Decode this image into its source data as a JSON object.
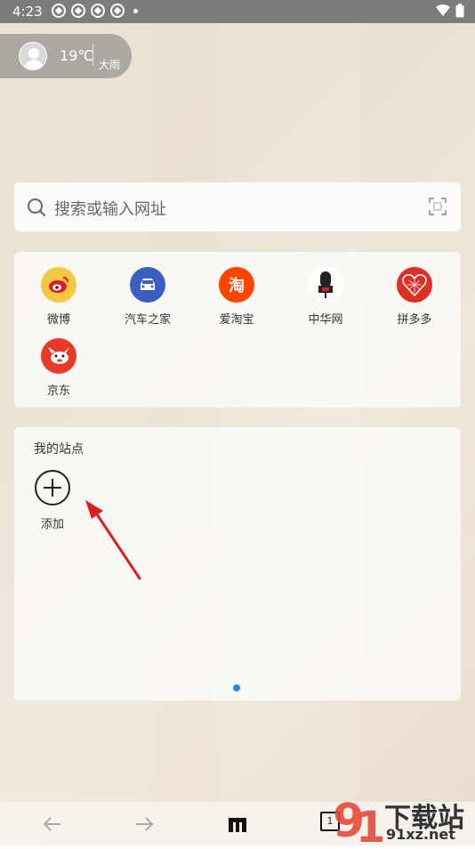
{
  "status_bar": {
    "time": "4:23"
  },
  "weather": {
    "temperature": "19℃",
    "condition": "大雨"
  },
  "search": {
    "placeholder": "搜索或输入网址"
  },
  "quick_links": [
    {
      "label": "微博",
      "icon": "weibo-icon",
      "color": "#f5c843"
    },
    {
      "label": "汽车之家",
      "icon": "autohome-icon",
      "color": "#3b5fc0"
    },
    {
      "label": "爱淘宝",
      "icon": "taobao-icon",
      "icon_text": "淘",
      "color": "#ff4400"
    },
    {
      "label": "中华网",
      "icon": "china-com-icon",
      "color": "#ffffff"
    },
    {
      "label": "拼多多",
      "icon": "pinduoduo-icon",
      "color": "#e02e24"
    },
    {
      "label": "京东",
      "icon": "jd-icon",
      "color": "#e83828"
    }
  ],
  "my_sites": {
    "title": "我的站点",
    "add_label": "添加"
  },
  "pager": {
    "current": 1,
    "total": 1
  },
  "bottom_bar": {
    "tabs_count": "1"
  },
  "watermark": {
    "text_top": "下载站",
    "text_bottom": "91xz.net"
  }
}
